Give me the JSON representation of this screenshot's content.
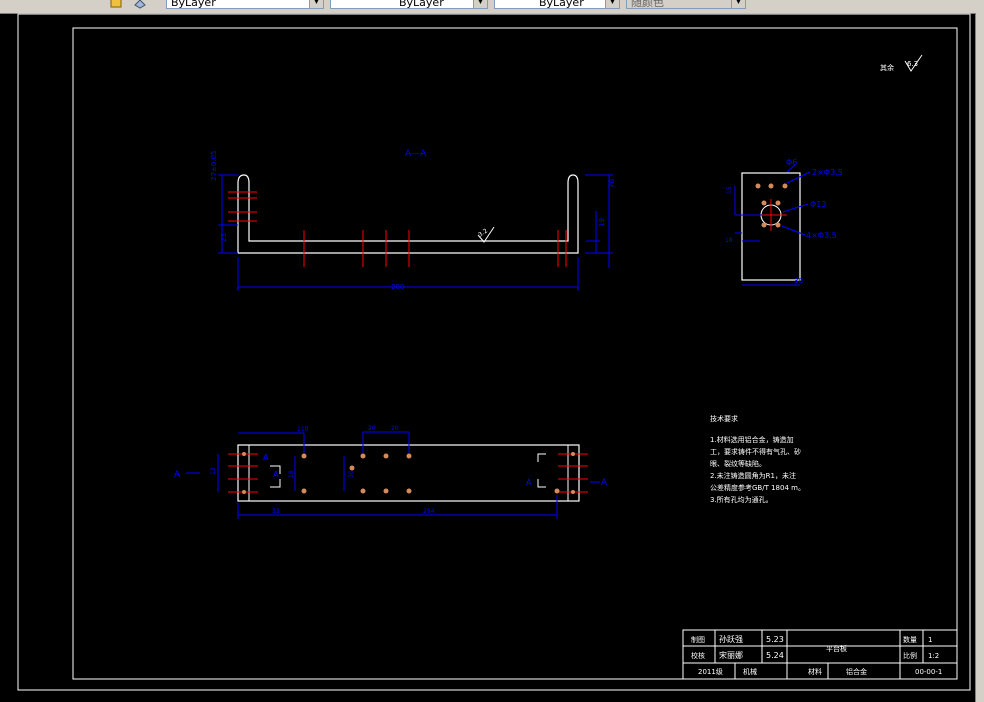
{
  "toolbar": {
    "color_combo": "ByLayer",
    "linetype_combo": "ByLayer",
    "lineweight_combo": "ByLayer",
    "plotstyle_combo": "随颜色"
  },
  "icons": [
    "layer-state-icon",
    "layer-manager-icon",
    "dropdown-arrow-icon"
  ],
  "colors": {
    "background": "#000000",
    "outline": "#ffffff",
    "dimension": "#0000ff",
    "centerline": "#ff0000",
    "hole": "#d48a5a",
    "toolbar": "#d4d0c8"
  },
  "drawing": {
    "roughness_rest": "其余",
    "roughness_rest_value": "6.3",
    "section_label": "A—A",
    "front_view": {
      "dim_top_thickness": "27±0.05",
      "dim_vert": "23",
      "dim_right_height": "70",
      "dim_right_inner": "19",
      "dim_length": "200",
      "roughness": "3.2"
    },
    "side_view": {
      "phi6": "Φ6",
      "holes_small": "2×Φ3.5",
      "phi13": "Φ13",
      "holes_small_4": "4×Φ3.5",
      "dim_top": "15",
      "dim_left": "18",
      "dim_width": "30"
    },
    "top_view": {
      "dim_110": "110",
      "dim_20a": "20",
      "dim_20b": "20",
      "dim_30": "30",
      "dim_12": "12",
      "dim_18": "18",
      "dim_32": "32",
      "dim_254": "254",
      "section_a": "A"
    },
    "tech_requirements": {
      "title": "技术要求",
      "lines": [
        "1.材料选用铝合金，铸造加",
        "工，要求铸件不得有气孔、砂",
        "眼、裂纹等缺陷。",
        "2.未注铸造圆角为R1，未注",
        "公差精度参考GB/T 1804 m。",
        "3.所有孔均为通孔。"
      ]
    },
    "title_block": {
      "draw_label": "制图",
      "draw_name": "孙跃强",
      "draw_date": "5.23",
      "check_label": "校核",
      "check_name": "宋丽娜",
      "check_date": "5.24",
      "part_name": "平台板",
      "qty_label": "数量",
      "qty_value": "1",
      "scale_label": "比例",
      "scale_value": "1:2",
      "class": "2011级",
      "major": "机械",
      "material_label": "材料",
      "material_value": "铝合金",
      "drawing_no": "00-00-1"
    }
  }
}
